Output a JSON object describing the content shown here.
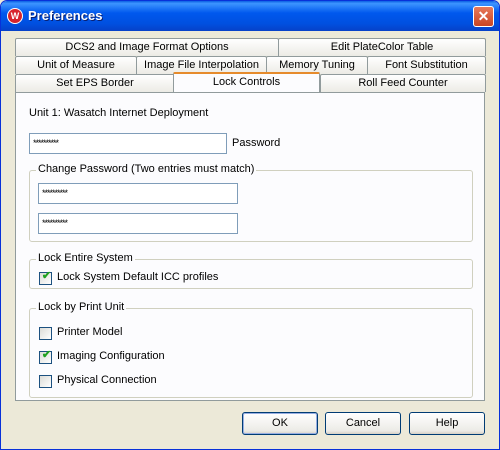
{
  "window": {
    "title": "Preferences",
    "app_icon_glyph": "W"
  },
  "tabs": {
    "row1": [
      "DCS2 and Image Format Options",
      "Edit PlateColor Table"
    ],
    "row2": [
      "Unit of Measure",
      "Image File Interpolation",
      "Memory Tuning",
      "Font Substitution"
    ],
    "row3": [
      "Set EPS Border",
      "Lock Controls",
      "Roll Feed Counter"
    ],
    "active": "Lock Controls"
  },
  "lock_controls": {
    "unit_label": "Unit 1: Wasatch  Internet Deployment",
    "password": {
      "value": "**********",
      "label": "Password"
    },
    "change_password": {
      "legend": "Change Password (Two entries must match)",
      "entry1": "**********",
      "entry2": "**********"
    },
    "lock_entire_system": {
      "legend": "Lock Entire System",
      "items": [
        {
          "label": "Lock System Default ICC profiles",
          "checked": true
        }
      ]
    },
    "lock_by_print_unit": {
      "legend": "Lock by Print Unit",
      "items": [
        {
          "label": "Printer Model",
          "checked": false
        },
        {
          "label": "Imaging Configuration",
          "checked": true
        },
        {
          "label": "Physical Connection",
          "checked": false
        }
      ]
    }
  },
  "buttons": {
    "ok": "OK",
    "cancel": "Cancel",
    "help": "Help"
  },
  "colors": {
    "titlebar": "#0058ee",
    "face": "#ece9d8",
    "active_tab_accent": "#e68b2c",
    "check": "#21a121"
  },
  "icons": {
    "close": "close-icon",
    "check": "checkmark-icon"
  }
}
